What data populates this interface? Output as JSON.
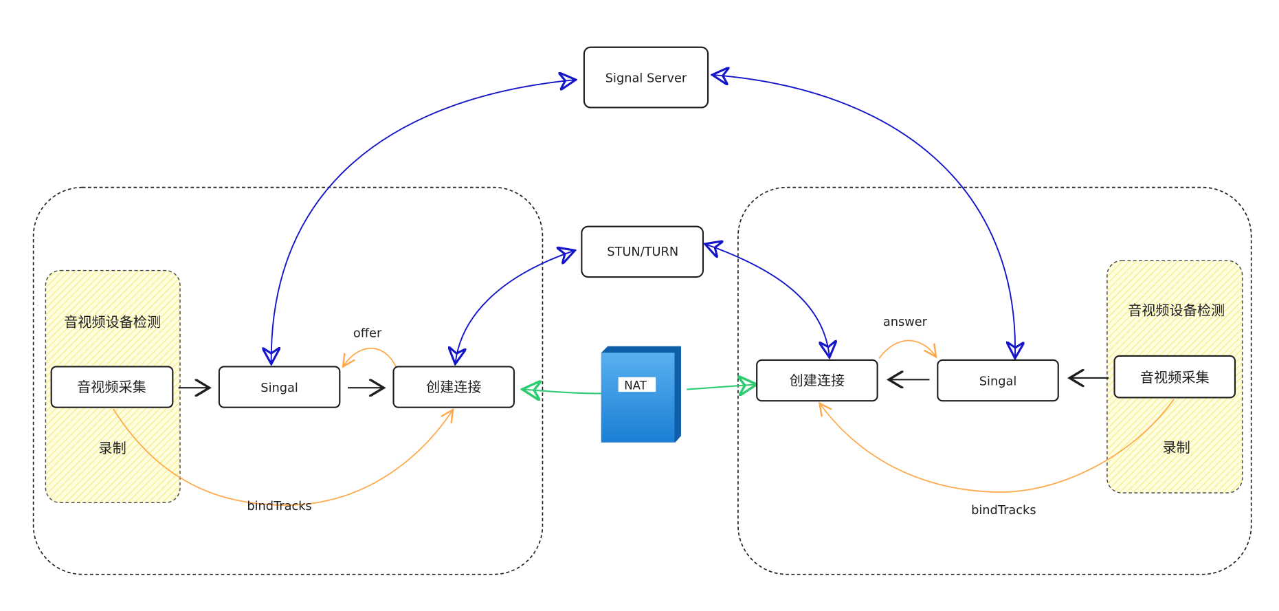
{
  "nodes": {
    "signal_server": "Signal Server",
    "stun_turn": "STUN/TURN",
    "nat": "NAT",
    "left": {
      "device_detect": "音视频设备检测",
      "capture": "音视频采集",
      "record": "录制",
      "signal": "Singal",
      "connect": "创建连接"
    },
    "right": {
      "device_detect": "音视频设备检测",
      "capture": "音视频采集",
      "record": "录制",
      "signal": "Singal",
      "connect": "创建连接"
    }
  },
  "edge_labels": {
    "offer": "offer",
    "answer": "answer",
    "bind_tracks_left": "bindTracks",
    "bind_tracks_right": "bindTracks"
  },
  "colors": {
    "signaling": "#1414c8",
    "media": "#ffa94d",
    "nat_link": "#2ecc71",
    "highlight": "#fff59d",
    "nat_fill": "#2b8fe0"
  }
}
